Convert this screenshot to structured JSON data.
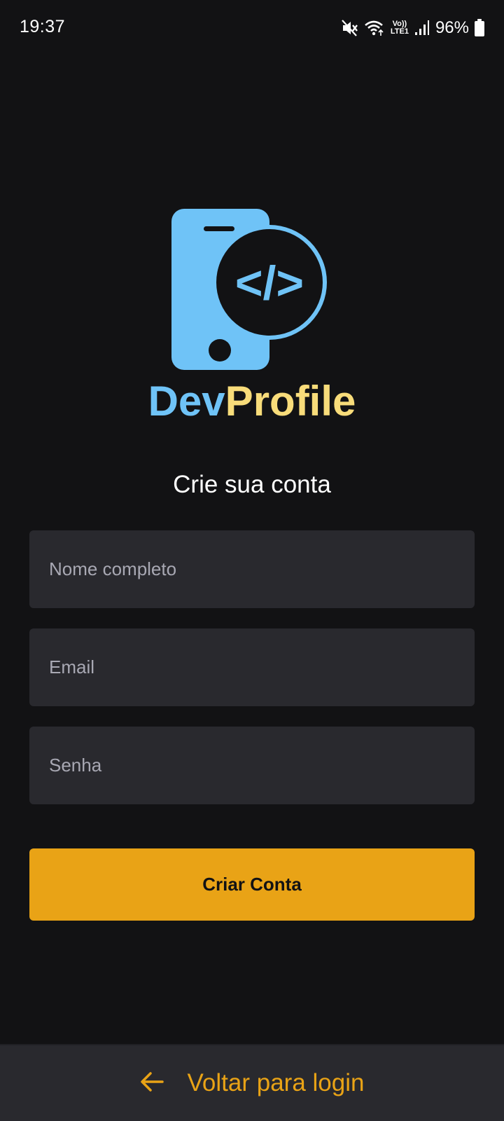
{
  "status_bar": {
    "time": "19:37",
    "battery_percent": "96%",
    "icons": [
      "mute-icon",
      "wifi-icon",
      "volte-icon",
      "signal-icon",
      "battery-icon"
    ],
    "volte_label_top": "Vo))",
    "volte_label_bottom": "LTE1"
  },
  "logo": {
    "brand_part1": "Dev",
    "brand_part2": "Profile",
    "code_symbol": "</>",
    "colors": {
      "blue": "#6fc3f7",
      "yellow": "#f8dc7a"
    }
  },
  "form": {
    "title": "Crie sua conta",
    "name_placeholder": "Nome completo",
    "email_placeholder": "Email",
    "password_placeholder": "Senha",
    "submit_label": "Criar Conta"
  },
  "footer": {
    "back_label": "Voltar para login",
    "icon": "arrow-left-icon"
  },
  "colors": {
    "background": "#121214",
    "input_bg": "#29292e",
    "accent": "#e9a316"
  }
}
